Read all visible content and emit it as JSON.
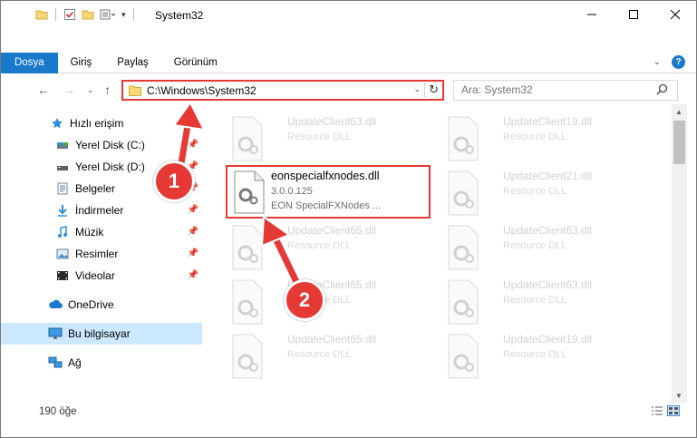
{
  "window": {
    "title": "System32"
  },
  "ribbon": {
    "tabs": [
      {
        "label": "Dosya",
        "active": true
      },
      {
        "label": "Giriş",
        "active": false
      },
      {
        "label": "Paylaş",
        "active": false
      },
      {
        "label": "Görünüm",
        "active": false
      }
    ],
    "help_label": "?"
  },
  "address": {
    "path": "C:\\Windows\\System32"
  },
  "search": {
    "placeholder": "Ara: System32"
  },
  "sidebar": {
    "items": [
      {
        "label": "Hızlı erişim",
        "icon": "star-icon"
      },
      {
        "label": "Yerel Disk (C:)",
        "icon": "drive-icon",
        "pinned": true
      },
      {
        "label": "Yerel Disk (D:)",
        "icon": "drive-icon",
        "pinned": true
      },
      {
        "label": "Belgeler",
        "icon": "documents-icon",
        "pinned": true
      },
      {
        "label": "İndirmeler",
        "icon": "download-icon",
        "pinned": true
      },
      {
        "label": "Müzik",
        "icon": "music-icon",
        "pinned": true
      },
      {
        "label": "Resimler",
        "icon": "pictures-icon",
        "pinned": true
      },
      {
        "label": "Videolar",
        "icon": "videos-icon",
        "pinned": true
      },
      {
        "label": "OneDrive",
        "icon": "cloud-icon"
      },
      {
        "label": "Bu bilgisayar",
        "icon": "computer-icon",
        "selected": true
      },
      {
        "label": "Ağ",
        "icon": "network-icon"
      }
    ]
  },
  "files": {
    "left": [
      {
        "name": "UpdateClient63.dll",
        "desc": "Resource DLL"
      },
      {
        "name": "UpdateClient65.dll",
        "desc": "Resource DLL"
      },
      {
        "name": "UpdateClient65.dll",
        "desc": "Resource DLL"
      },
      {
        "name": "UpdateClient65.dll",
        "desc": "Resource DLL"
      }
    ],
    "right": [
      {
        "name": "UpdateClient19.dll",
        "desc": "Resource DLL"
      },
      {
        "name": "UpdateClient21.dll",
        "desc": "Resource DLL"
      },
      {
        "name": "UpdateClient63.dll",
        "desc": "Resource DLL"
      },
      {
        "name": "UpdateClient63.dll",
        "desc": "Resource DLL"
      },
      {
        "name": "UpdateClient19.dll",
        "desc": "Resource DLL"
      }
    ],
    "highlighted": {
      "name": "eonspecialfxnodes.dll",
      "version": "3.0.0.125",
      "description": "EON SpecialFXNodes ..."
    }
  },
  "status": {
    "item_count": "190 öğe"
  },
  "callouts": {
    "step1": "1",
    "step2": "2"
  },
  "colors": {
    "accent": "#1979ca",
    "highlight": "#e53935",
    "selection": "#cce8ff"
  }
}
